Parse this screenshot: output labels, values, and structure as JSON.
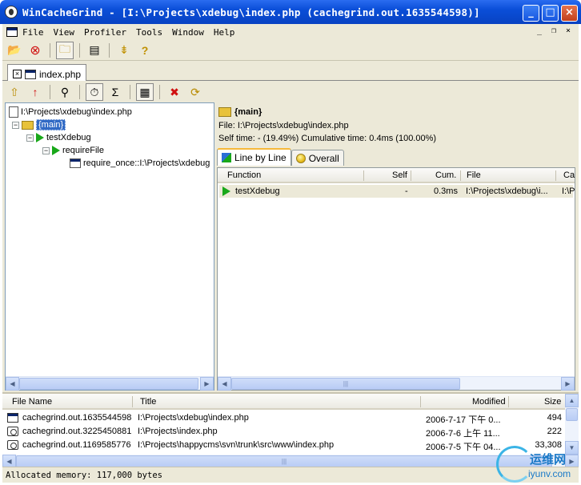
{
  "window": {
    "title": "WinCacheGrind - [I:\\Projects\\xdebug\\index.php (cachegrind.out.1635544598)]",
    "minimize": "_",
    "maximize": "□",
    "close": "×"
  },
  "menu": {
    "items": [
      "File",
      "View",
      "Profiler",
      "Tools",
      "Window",
      "Help"
    ],
    "mdi_min": "_",
    "mdi_restore": "❐",
    "mdi_close": "×"
  },
  "toolbar": {
    "open": "📂",
    "stop": "⊗",
    "folder": "🗀",
    "props": "▤",
    "run": "⇟",
    "help": "?"
  },
  "document_tab": {
    "label": "index.php",
    "close": "×"
  },
  "toolbar2": {
    "up_folder": "⇧",
    "up": "↑",
    "find": "⚲",
    "timer": "⏱",
    "sum": "Σ",
    "mode": "▦",
    "delete": "✖",
    "refresh": "⟳"
  },
  "tree": {
    "root": "I:\\Projects\\xdebug\\index.php",
    "main": "{main}",
    "child1": "testXdebug",
    "child2": "requireFile",
    "child3": "require_once::I:\\Projects\\xdebug",
    "collapse": "−"
  },
  "detail": {
    "name": "{main}",
    "file": "File: I:\\Projects\\xdebug\\index.php",
    "times": "Self time: - (19.49%)  Cumulative time: 0.4ms (100.00%)",
    "tabs": [
      "Line by Line",
      "Overall"
    ],
    "columns": [
      "Function",
      "Self",
      "Cum.",
      "File",
      "Ca"
    ],
    "row": {
      "function": "testXdebug",
      "self": "-",
      "cum": "0.3ms",
      "file": "I:\\Projects\\xdebug\\i...",
      "ca": "I:\\P"
    }
  },
  "files": {
    "columns": [
      "File Name",
      "Title",
      "Modified",
      "Size"
    ],
    "rows": [
      {
        "name": "cachegrind.out.1635544598",
        "title": "I:\\Projects\\xdebug\\index.php",
        "modified": "2006-7-17 下午 0...",
        "size": "494",
        "icon": "grid-file-icon"
      },
      {
        "name": "cachegrind.out.3225450881",
        "title": "I:\\Projects\\index.php",
        "modified": "2006-7-6 上午 11...",
        "size": "222",
        "icon": "clock-file-icon"
      },
      {
        "name": "cachegrind.out.1169585776",
        "title": "I:\\Projects\\happycms\\svn\\trunk\\src\\www\\index.php",
        "modified": "2006-7-5 下午 04...",
        "size": "33,308",
        "icon": "clock-file-icon"
      }
    ]
  },
  "scroll": {
    "left": "◀",
    "right": "▶",
    "up": "▲",
    "down": "▼",
    "grip": "|||"
  },
  "status": "Allocated memory: 117,000 bytes",
  "watermark": {
    "line1": "运维网",
    "line2": "iyunv.com"
  }
}
